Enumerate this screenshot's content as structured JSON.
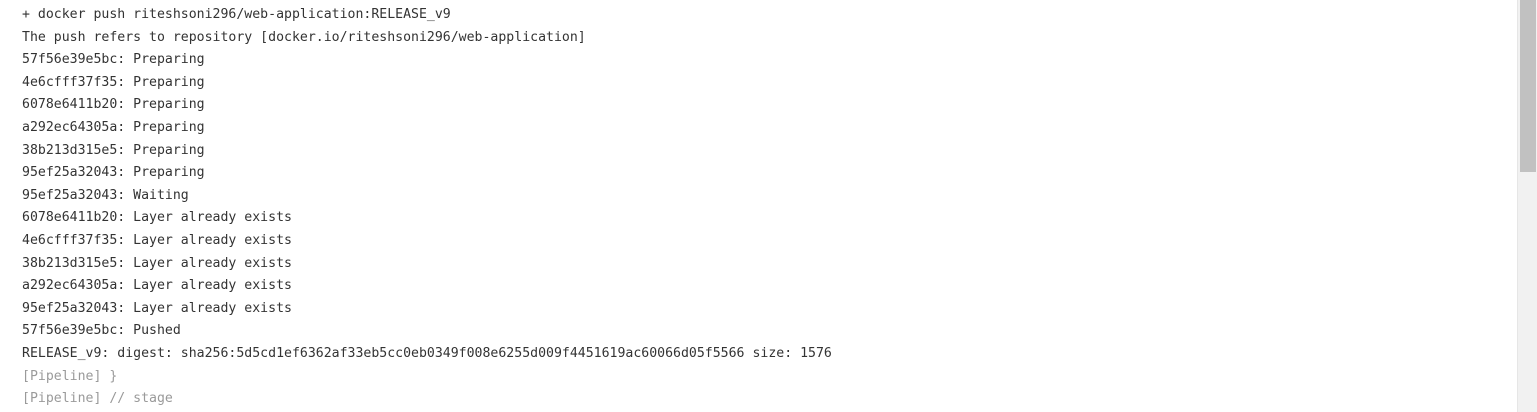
{
  "console": {
    "lines": [
      {
        "text": "+ docker push riteshsoni296/web-application:RELEASE_v9",
        "kind": "output"
      },
      {
        "text": "The push refers to repository [docker.io/riteshsoni296/web-application]",
        "kind": "output"
      },
      {
        "text": "57f56e39e5bc: Preparing",
        "kind": "output"
      },
      {
        "text": "4e6cfff37f35: Preparing",
        "kind": "output"
      },
      {
        "text": "6078e6411b20: Preparing",
        "kind": "output"
      },
      {
        "text": "a292ec64305a: Preparing",
        "kind": "output"
      },
      {
        "text": "38b213d315e5: Preparing",
        "kind": "output"
      },
      {
        "text": "95ef25a32043: Preparing",
        "kind": "output"
      },
      {
        "text": "95ef25a32043: Waiting",
        "kind": "output"
      },
      {
        "text": "6078e6411b20: Layer already exists",
        "kind": "output"
      },
      {
        "text": "4e6cfff37f35: Layer already exists",
        "kind": "output"
      },
      {
        "text": "38b213d315e5: Layer already exists",
        "kind": "output"
      },
      {
        "text": "a292ec64305a: Layer already exists",
        "kind": "output"
      },
      {
        "text": "95ef25a32043: Layer already exists",
        "kind": "output"
      },
      {
        "text": "57f56e39e5bc: Pushed",
        "kind": "output"
      },
      {
        "text": "RELEASE_v9: digest: sha256:5d5cd1ef6362af33eb5cc0eb0349f008e6255d009f4451619ac60066d05f5566 size: 1576",
        "kind": "output"
      },
      {
        "text": "[Pipeline] }",
        "kind": "pipeline"
      },
      {
        "text": "[Pipeline] // stage",
        "kind": "pipeline"
      }
    ]
  },
  "colors": {
    "output_text": "#333333",
    "pipeline_text": "#9a9a9a",
    "background": "#ffffff",
    "scrollbar_track": "#f1f1f1",
    "scrollbar_thumb": "#c1c1c1"
  }
}
